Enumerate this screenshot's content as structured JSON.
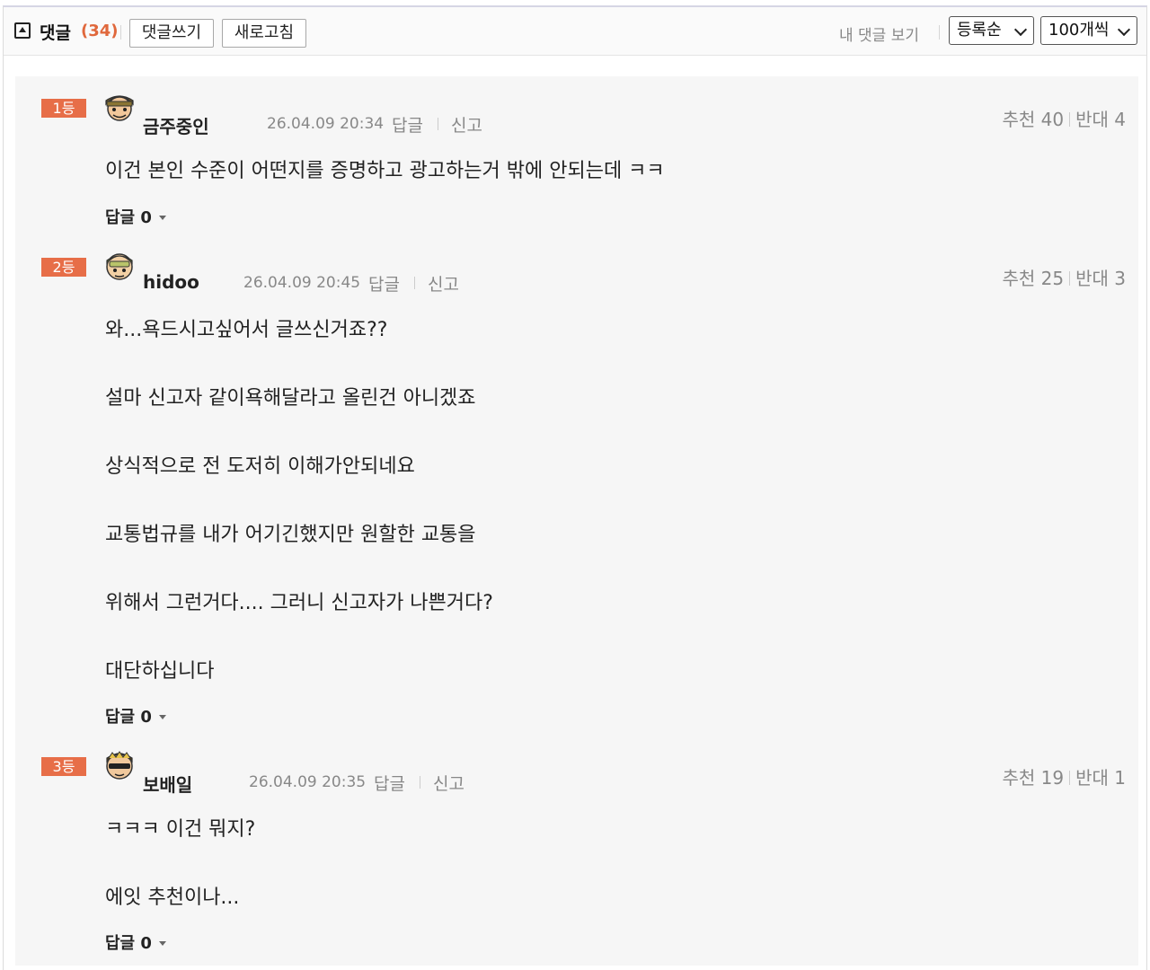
{
  "header": {
    "title": "댓글",
    "count": "(34)",
    "write_button": "댓글쓰기",
    "refresh_button": "새로고침",
    "my_comments": "내 댓글 보기",
    "sort_select": "등록순",
    "per_page_select": "100개씩"
  },
  "colors": {
    "accent": "#e76e48",
    "count": "#e0683c"
  },
  "comments": [
    {
      "rank": "1등",
      "nickname": "금주중인",
      "date": "26.04.09 20:34",
      "reply_link": "답글",
      "report_link": "신고",
      "recommend": "추천 40",
      "oppose": "반대 4",
      "lines": [
        "이건 본인 수준이 어떤지를 증명하고 광고하는거 밖에 안되는데 ㅋㅋ"
      ],
      "replies": "답글 0",
      "avatar_icon": "avatar-icon"
    },
    {
      "rank": "2등",
      "nickname": "hidoo",
      "date": "26.04.09 20:45",
      "reply_link": "답글",
      "report_link": "신고",
      "recommend": "추천 25",
      "oppose": "반대 3",
      "lines": [
        "와...욕드시고싶어서 글쓰신거죠??",
        "설마 신고자 같이욕해달라고 올린건 아니겠죠",
        "상식적으로 전 도저히 이해가안되네요",
        "교통법규를 내가 어기긴했지만 원할한 교통을",
        "위해서 그런거다.... 그러니 신고자가 나쁜거다?",
        "대단하십니다"
      ],
      "replies": "답글 0",
      "avatar_icon": "avatar-icon"
    },
    {
      "rank": "3등",
      "nickname": "보배일",
      "date": "26.04.09 20:35",
      "reply_link": "답글",
      "report_link": "신고",
      "recommend": "추천 19",
      "oppose": "반대 1",
      "lines": [
        "ㅋㅋㅋ 이건 뭐지?",
        "에잇 추천이나..."
      ],
      "replies": "답글 0",
      "avatar_icon": "avatar-icon"
    }
  ]
}
